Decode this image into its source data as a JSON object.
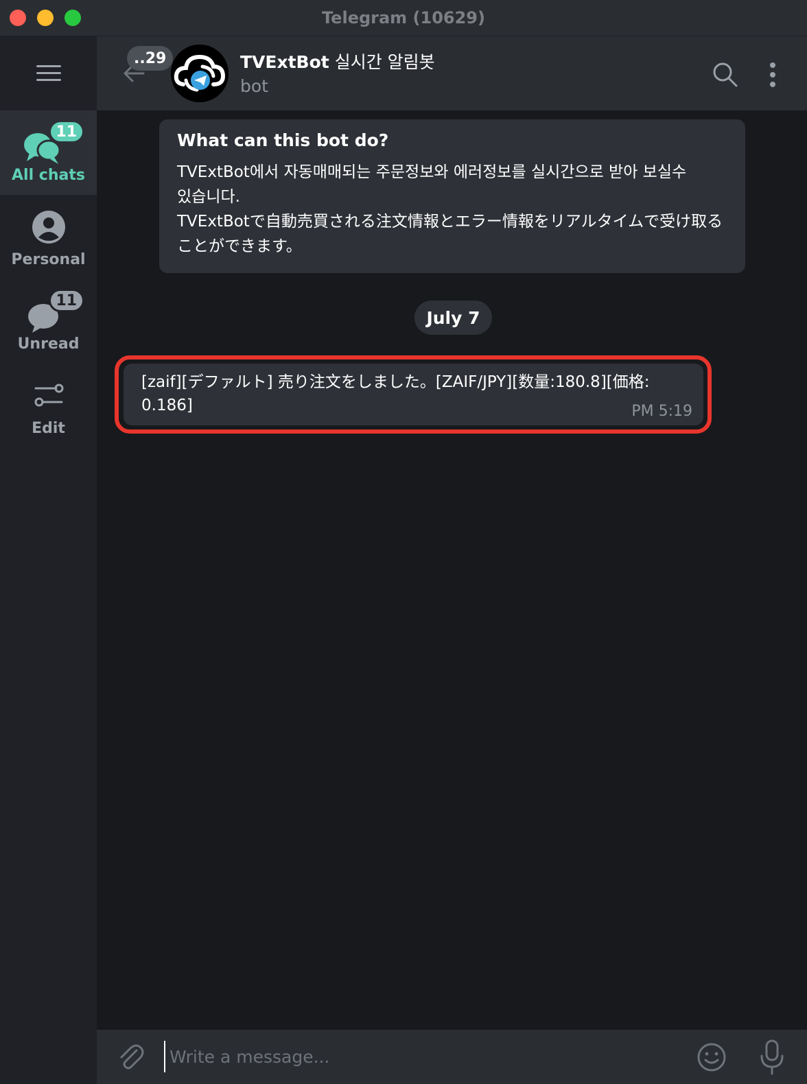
{
  "window": {
    "title": "Telegram (10629)"
  },
  "sidebar": {
    "menu_icon": "hamburger-icon",
    "folders": [
      {
        "label": "All chats",
        "badge": "11",
        "icon": "chats-icon",
        "active": true
      },
      {
        "label": "Personal",
        "badge": "",
        "icon": "person-icon",
        "active": false
      },
      {
        "label": "Unread",
        "badge": "11",
        "icon": "unread-chat-icon",
        "active": false
      },
      {
        "label": "Edit",
        "badge": "",
        "icon": "sliders-icon",
        "active": false
      }
    ]
  },
  "header": {
    "back_badge": "..29",
    "chat_name": "TVExtBot",
    "chat_name_suffix": " 실시간 알림봇",
    "status": "bot",
    "avatar_icon": "cloud-telegram-logo"
  },
  "intro": {
    "title": "What can this bot do?",
    "lines": [
      "TVExtBot에서 자동매매되는 주문정보와 에러정보를 실시간으로 받아 보실수",
      "있습니다.",
      "TVExtBotで自動売買される注文情報とエラー情報をリアルタイムで受け取る",
      "ことができます。"
    ]
  },
  "date_separator": "July 7",
  "messages": [
    {
      "line1": "[zaif][デファルト] 売り注文をしました。[ZAIF/JPY][数量:180.8][価格:",
      "line2": "0.186]",
      "time": "PM 5:19"
    }
  ],
  "composer": {
    "placeholder": "Write a message..."
  },
  "colors": {
    "accent": "#5fcfb6",
    "highlight": "#e8352c",
    "background": "#17191d",
    "bubble": "#2e3137"
  }
}
